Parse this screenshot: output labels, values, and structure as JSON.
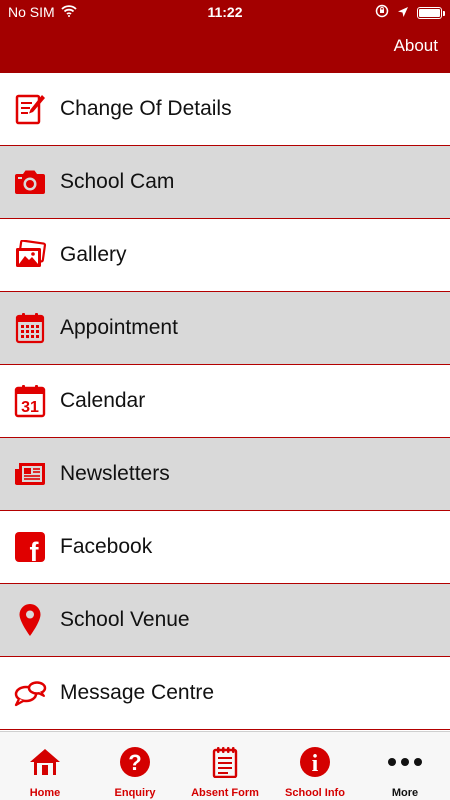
{
  "status_bar": {
    "carrier": "No SIM",
    "time": "11:22"
  },
  "nav_bar": {
    "about_label": "About"
  },
  "menu": {
    "items": [
      {
        "label": "Change Of Details",
        "icon": "edit-form-icon",
        "shaded": false
      },
      {
        "label": "School Cam",
        "icon": "camera-icon",
        "shaded": true
      },
      {
        "label": "Gallery",
        "icon": "gallery-icon",
        "shaded": false
      },
      {
        "label": "Appointment",
        "icon": "appointment-calendar-icon",
        "shaded": true
      },
      {
        "label": "Calendar",
        "icon": "calendar-31-icon",
        "shaded": false
      },
      {
        "label": "Newsletters",
        "icon": "newspaper-icon",
        "shaded": true
      },
      {
        "label": "Facebook",
        "icon": "facebook-icon",
        "shaded": false
      },
      {
        "label": "School Venue",
        "icon": "map-pin-icon",
        "shaded": true
      },
      {
        "label": "Message Centre",
        "icon": "chat-bubbles-icon",
        "shaded": false
      }
    ],
    "calendar_day": "31",
    "facebook_glyph": "f"
  },
  "tab_bar": {
    "tabs": [
      {
        "label": "Home",
        "icon": "home-icon"
      },
      {
        "label": "Enquiry",
        "icon": "question-icon"
      },
      {
        "label": "Absent Form",
        "icon": "notepad-icon"
      },
      {
        "label": "School Info",
        "icon": "info-icon"
      },
      {
        "label": "More",
        "icon": "more-dots-icon"
      }
    ],
    "question_glyph": "?",
    "info_glyph": "i"
  },
  "colors": {
    "header": "#a30000",
    "accent": "#e00000",
    "shaded_row": "#d9d9d9",
    "divider": "#b30000"
  }
}
